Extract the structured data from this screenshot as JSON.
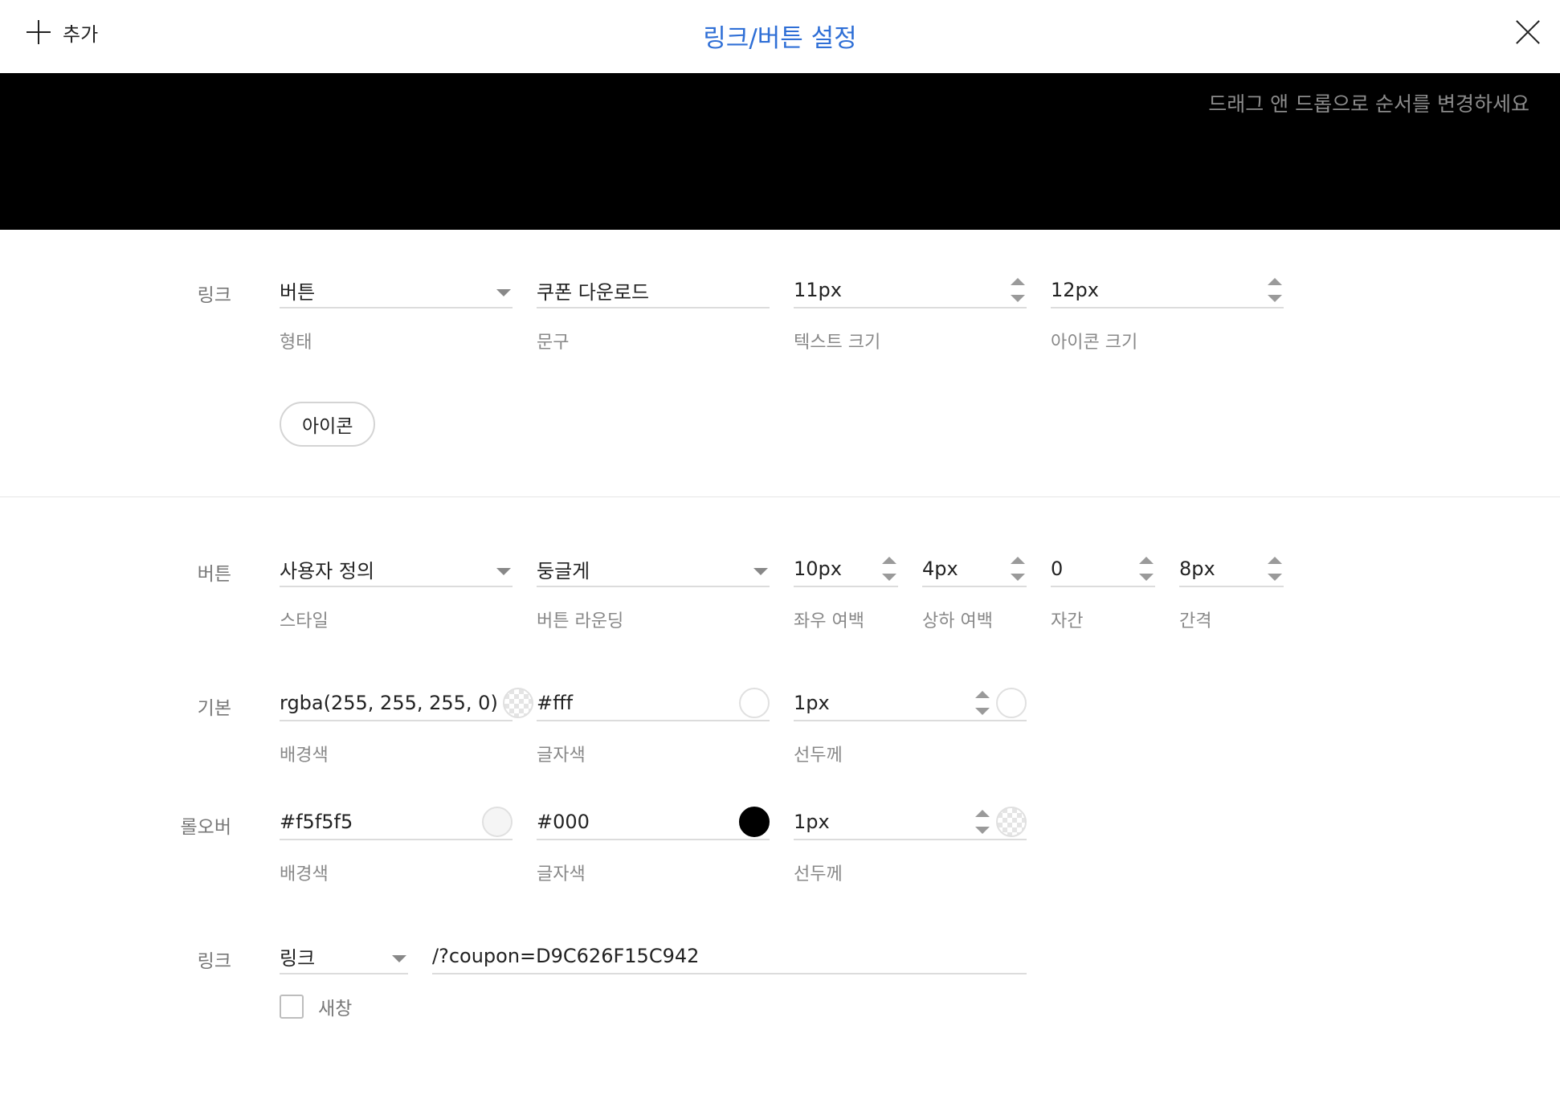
{
  "header": {
    "add_label": "추가",
    "title": "링크/버튼 설정"
  },
  "preview": {
    "hint": "드래그 앤 드롭으로 순서를 변경하세요",
    "background": "#000000"
  },
  "accent": "#2f6fd6",
  "link_section": {
    "label": "링크",
    "type": {
      "value": "버튼",
      "label": "형태"
    },
    "text": {
      "value": "쿠폰 다운로드",
      "label": "문구"
    },
    "text_size": {
      "value": "11px",
      "label": "텍스트 크기"
    },
    "icon_size": {
      "value": "12px",
      "label": "아이콘 크기"
    },
    "icon_button": "아이콘"
  },
  "button_section": {
    "label": "버튼",
    "style": {
      "value": "사용자 정의",
      "label": "스타일"
    },
    "rounding": {
      "value": "둥글게",
      "label": "버튼 라운딩"
    },
    "h_padding": {
      "value": "10px",
      "label": "좌우 여백"
    },
    "v_padding": {
      "value": "4px",
      "label": "상하 여백"
    },
    "letter_spacing": {
      "value": "0",
      "label": "자간"
    },
    "gap": {
      "value": "8px",
      "label": "간격"
    }
  },
  "default_section": {
    "label": "기본",
    "bg": {
      "value": "rgba(255, 255, 255, 0)",
      "label": "배경색",
      "swatch": "transparent"
    },
    "fg": {
      "value": "#fff",
      "label": "글자색",
      "swatch": "#ffffff"
    },
    "border": {
      "value": "1px",
      "label": "선두께",
      "swatch": "#ffffff"
    }
  },
  "rollover_section": {
    "label": "롤오버",
    "bg": {
      "value": "#f5f5f5",
      "label": "배경색",
      "swatch": "#f5f5f5"
    },
    "fg": {
      "value": "#000",
      "label": "글자색",
      "swatch": "#000000"
    },
    "border": {
      "value": "1px",
      "label": "선두께",
      "swatch": "transparent"
    }
  },
  "link_target_section": {
    "label": "링크",
    "type": {
      "value": "링크"
    },
    "url": {
      "value": "/?coupon=D9C626F15C942"
    },
    "new_window": {
      "label": "새창",
      "checked": false
    }
  },
  "icons": [
    "plus-icon",
    "close-icon",
    "chevron-down-icon",
    "stepper-icon",
    "color-swatch-icon",
    "checkbox-icon"
  ]
}
